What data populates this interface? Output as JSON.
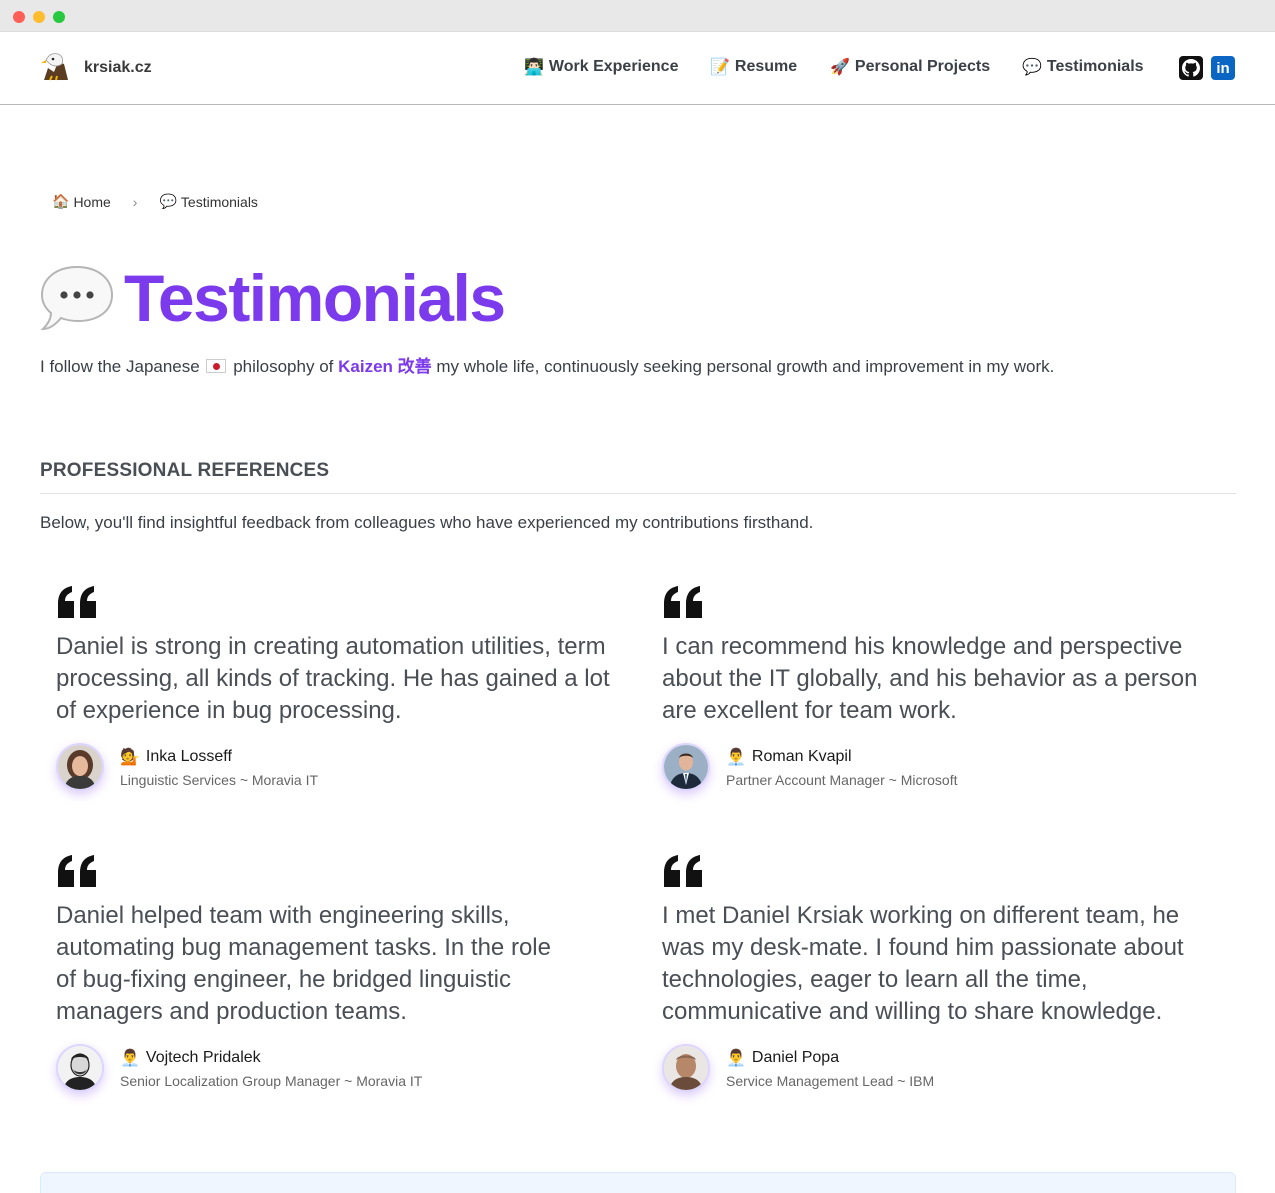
{
  "window": {
    "controls": [
      "close",
      "minimize",
      "zoom"
    ]
  },
  "navbar": {
    "brand": "krsiak.cz",
    "logo_icon": "eagle-icon",
    "items": [
      {
        "emoji": "👨🏻‍💻",
        "label": "Work Experience"
      },
      {
        "emoji": "📝",
        "label": "Resume"
      },
      {
        "emoji": "🚀",
        "label": "Personal Projects"
      },
      {
        "emoji": "💬",
        "label": "Testimonials"
      }
    ],
    "social": [
      {
        "icon": "github-icon"
      },
      {
        "icon": "linkedin-icon",
        "glyph": "in"
      }
    ]
  },
  "breadcrumb": {
    "home_emoji": "🏠",
    "home": "Home",
    "separator": "›",
    "current_emoji": "💬",
    "current": "Testimonials"
  },
  "page": {
    "title": "Testimonials",
    "title_icon": "speech-bubble-icon",
    "intro_before": "I follow the Japanese",
    "intro_mid": "philosophy of",
    "kaizen": "Kaizen 改善",
    "intro_after": "my whole life, continuously seeking personal growth and improvement in my work."
  },
  "references": {
    "heading": "PROFESSIONAL REFERENCES",
    "description": "Below, you'll find insightful feedback from colleagues who have experienced my contributions firsthand.",
    "items": [
      {
        "quote": "Daniel is strong in creating automation utilities, term processing, all kinds of tracking. He has gained a lot of experience in bug processing.",
        "emoji": "💁",
        "name": "Inka Losseff",
        "role": "Linguistic Services ~ Moravia IT"
      },
      {
        "quote": "I can recommend his knowledge and perspective about the IT globally, and his behavior as a person are excellent for team work.",
        "emoji": "👨‍💼",
        "name": "Roman Kvapil",
        "role": "Partner Account Manager ~ Microsoft"
      },
      {
        "quote": "Daniel helped team with engineering skills, automating bug management tasks. In the role of bug-fixing engineer, he bridged linguistic managers and production teams.",
        "emoji": "👨‍💼",
        "name": "Vojtech Pridalek",
        "role": "Senior Localization Group Manager ~ Moravia IT"
      },
      {
        "quote": "I met Daniel Krsiak working on different team, he was my desk-mate. I found him passionate about technologies, eager to learn all the time, communicative and willing to share knowledge.",
        "emoji": "👨‍💼",
        "name": "Daniel Popa",
        "role": "Service Management Lead ~ IBM"
      }
    ]
  },
  "colors": {
    "accent": "#7c3aed",
    "text": "#3a3f47",
    "linkedin": "#0a66c2"
  }
}
